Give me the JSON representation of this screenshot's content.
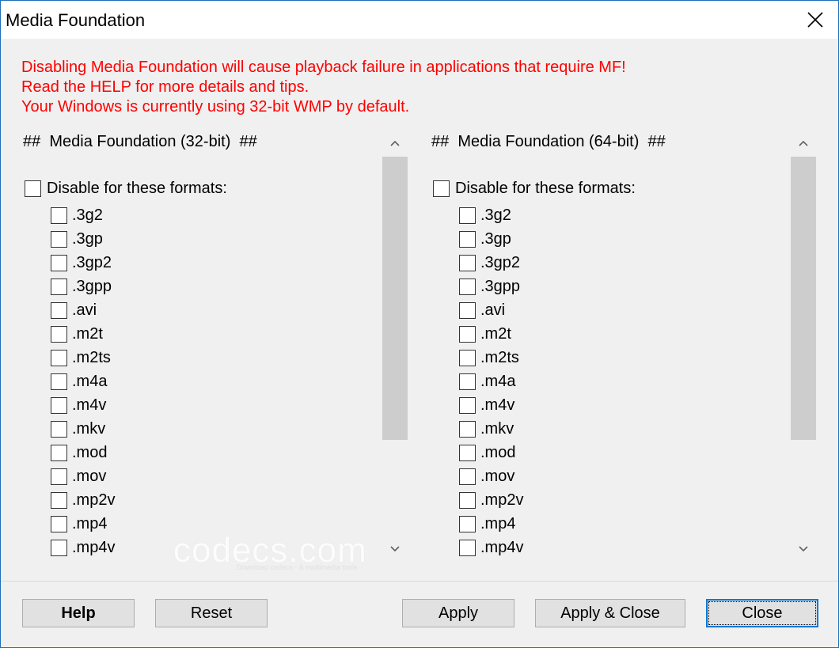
{
  "window": {
    "title": "Media Foundation"
  },
  "warning": {
    "line1": "Disabling Media Foundation will cause playback failure in applications that require MF!",
    "line2": "Read the HELP for more details and tips.",
    "line3": "Your Windows is currently using 32-bit WMP by default."
  },
  "colors": {
    "warning_text": "#ff0000",
    "accent": "#0078d7",
    "window_border": "#1c6fb8"
  },
  "panel32": {
    "header": "##  Media Foundation (32-bit)  ##",
    "master_label": "Disable for these formats:",
    "formats": [
      ".3g2",
      ".3gp",
      ".3gp2",
      ".3gpp",
      ".avi",
      ".m2t",
      ".m2ts",
      ".m4a",
      ".m4v",
      ".mkv",
      ".mod",
      ".mov",
      ".mp2v",
      ".mp4",
      ".mp4v"
    ]
  },
  "panel64": {
    "header": "##  Media Foundation (64-bit)  ##",
    "master_label": "Disable for these formats:",
    "formats": [
      ".3g2",
      ".3gp",
      ".3gp2",
      ".3gpp",
      ".avi",
      ".m2t",
      ".m2ts",
      ".m4a",
      ".m4v",
      ".mkv",
      ".mod",
      ".mov",
      ".mp2v",
      ".mp4",
      ".mp4v"
    ]
  },
  "watermark": {
    "text": "codecs.com",
    "subtext": "Download codecs - & multimedia tools"
  },
  "buttons": {
    "help": "Help",
    "reset": "Reset",
    "apply": "Apply",
    "apply_close": "Apply & Close",
    "close": "Close"
  },
  "icons": {
    "close": "close-icon",
    "scroll_up": "chevron-up-icon",
    "scroll_down": "chevron-down-icon"
  }
}
